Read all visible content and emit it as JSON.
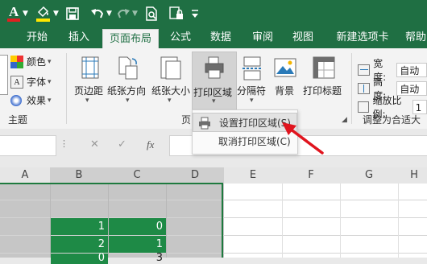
{
  "qat": {
    "font_color_letter": "A",
    "icons": [
      "font-color-icon",
      "fill-color-icon",
      "save-icon",
      "undo-icon",
      "redo-icon",
      "print-preview-icon",
      "protect-sheet-icon"
    ]
  },
  "tabs": [
    {
      "label": "开始"
    },
    {
      "label": "插入"
    },
    {
      "label": "页面布局"
    },
    {
      "label": "公式"
    },
    {
      "label": "数据"
    },
    {
      "label": "审阅"
    },
    {
      "label": "视图"
    },
    {
      "label": "新建选项卡"
    },
    {
      "label": "帮助"
    }
  ],
  "ribbon": {
    "theme_items": [
      "颜色",
      "字体",
      "效果"
    ],
    "theme_group": "主题",
    "buttons": {
      "margins": "页边距",
      "orientation": "纸张方向",
      "size": "纸张大小",
      "print_area": "打印区域",
      "breaks": "分隔符",
      "background": "背景",
      "print_titles": "打印标题"
    },
    "page_setup_group_partial": "页",
    "scale": {
      "width_label": "宽度:",
      "width_value": "自动",
      "height_label": "高度:",
      "height_value": "自动",
      "scale_label": "缩放比例:",
      "scale_value": "1",
      "group": "调整为合适大"
    }
  },
  "print_area_menu": {
    "items": [
      {
        "label": "设置打印区域(S)"
      },
      {
        "label": "取消打印区域(C)"
      }
    ]
  },
  "formula_bar": {
    "cancel": "✕",
    "enter": "✓",
    "fx": "fx"
  },
  "grid": {
    "columns": [
      "A",
      "B",
      "C",
      "D",
      "E",
      "F",
      "G",
      "H"
    ],
    "rows": [
      {
        "B": "",
        "C": ""
      },
      {
        "B": "1",
        "C": "0"
      },
      {
        "B": "2",
        "C": "1"
      },
      {
        "B": "0",
        "C": "3"
      }
    ]
  },
  "colors": {
    "accent": "#1f6f43",
    "selection": "#c6c6c6",
    "highlight_green": "#1e8a46",
    "annotation_arrow": "#e0141e"
  }
}
